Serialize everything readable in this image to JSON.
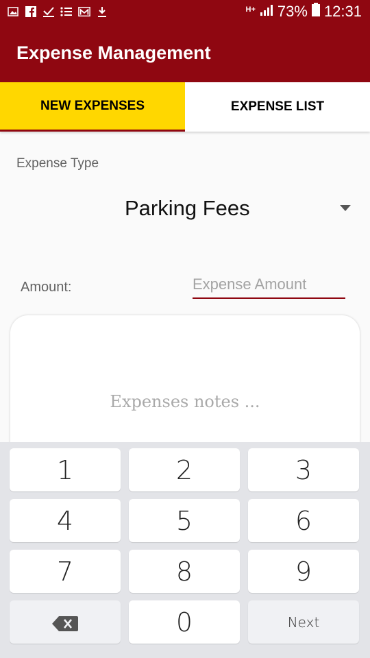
{
  "status_bar": {
    "network_label": "H+",
    "battery": "73%",
    "time": "12:31",
    "left_icons": [
      "image-icon",
      "facebook-icon",
      "check-icon",
      "list-icon",
      "gmail-icon",
      "download-icon"
    ]
  },
  "app": {
    "title": "Expense Management"
  },
  "tabs": [
    {
      "label": "NEW EXPENSES",
      "active": true
    },
    {
      "label": "EXPENSE LIST",
      "active": false
    }
  ],
  "form": {
    "type_label": "Expense Type",
    "type_value": "Parking Fees",
    "amount_label": "Amount:",
    "amount_value": "",
    "amount_placeholder": "Expense Amount",
    "notes_value": "",
    "notes_placeholder": "Expenses notes ..."
  },
  "keyboard": {
    "keys": [
      "1",
      "2",
      "3",
      "4",
      "5",
      "6",
      "7",
      "8",
      "9",
      "",
      "0",
      "Next"
    ],
    "icons": {
      "backspace": "backspace-icon"
    }
  },
  "colors": {
    "primary": "#8f0711",
    "tab_active": "#ffd700",
    "keyboard_bg": "#e3e4e8"
  }
}
